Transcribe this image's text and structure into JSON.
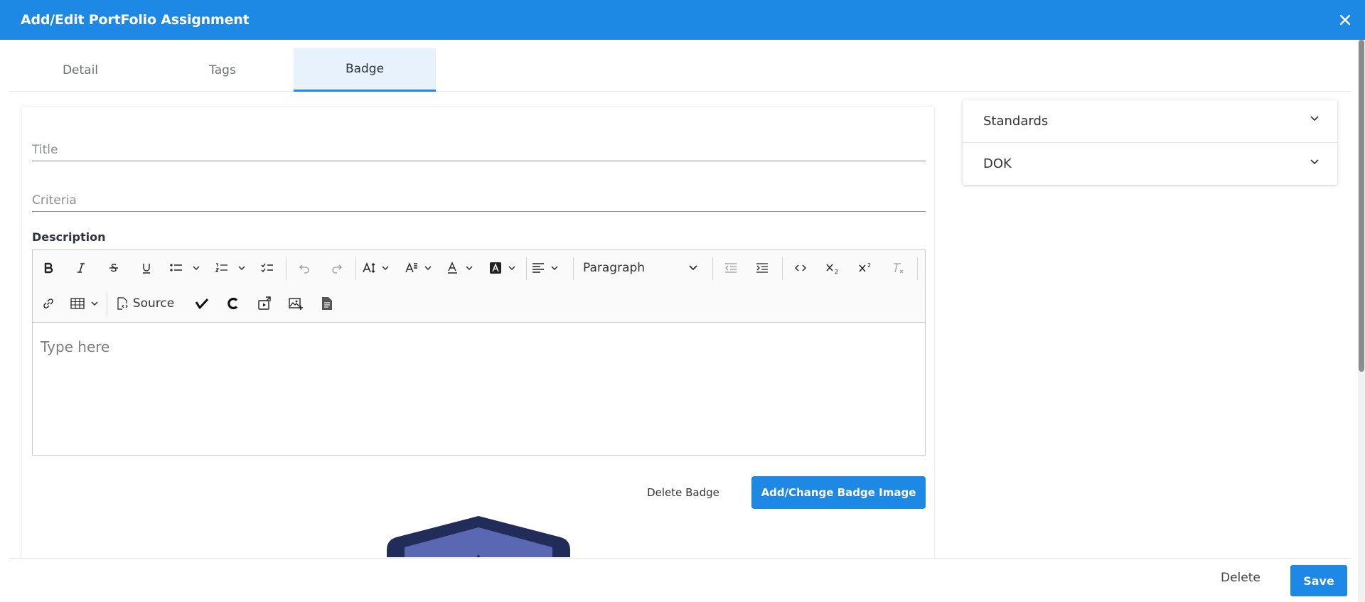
{
  "header": {
    "title": "Add/Edit PortFolio Assignment"
  },
  "tabs": [
    {
      "label": "Detail"
    },
    {
      "label": "Tags"
    },
    {
      "label": "Badge"
    }
  ],
  "form": {
    "title_placeholder": "Title",
    "title_value": "",
    "criteria_placeholder": "Criteria",
    "criteria_value": "",
    "description_label": "Description",
    "editor_placeholder": "Type here"
  },
  "toolbar": {
    "heading_select": "Paragraph",
    "source_label": "Source",
    "icons": [
      "bold-icon",
      "italic-icon",
      "strikethrough-icon",
      "underline-icon",
      "bulleted-list-icon",
      "numbered-list-icon",
      "todo-list-icon",
      "undo-icon",
      "redo-icon",
      "font-size-icon",
      "font-family-icon",
      "font-color-icon",
      "font-background-icon",
      "alignment-icon",
      "outdent-icon",
      "indent-icon",
      "code-icon",
      "subscript-icon",
      "superscript-icon",
      "remove-format-icon",
      "link-icon",
      "table-icon",
      "source-icon",
      "checkmark-icon",
      "c-logo-icon",
      "media-icon",
      "image-icon",
      "document-icon"
    ]
  },
  "badge_actions": {
    "delete_label": "Delete Badge",
    "add_change_label": "Add/Change Badge Image"
  },
  "accordion": [
    {
      "label": "Standards"
    },
    {
      "label": "DOK"
    }
  ],
  "footer": {
    "delete_label": "Delete",
    "save_label": "Save"
  },
  "colors": {
    "primary": "#1e88e5",
    "active_tab_bg": "#e8f2fc",
    "badge_dark": "#222c59",
    "badge_inner": "#5a68b3"
  }
}
